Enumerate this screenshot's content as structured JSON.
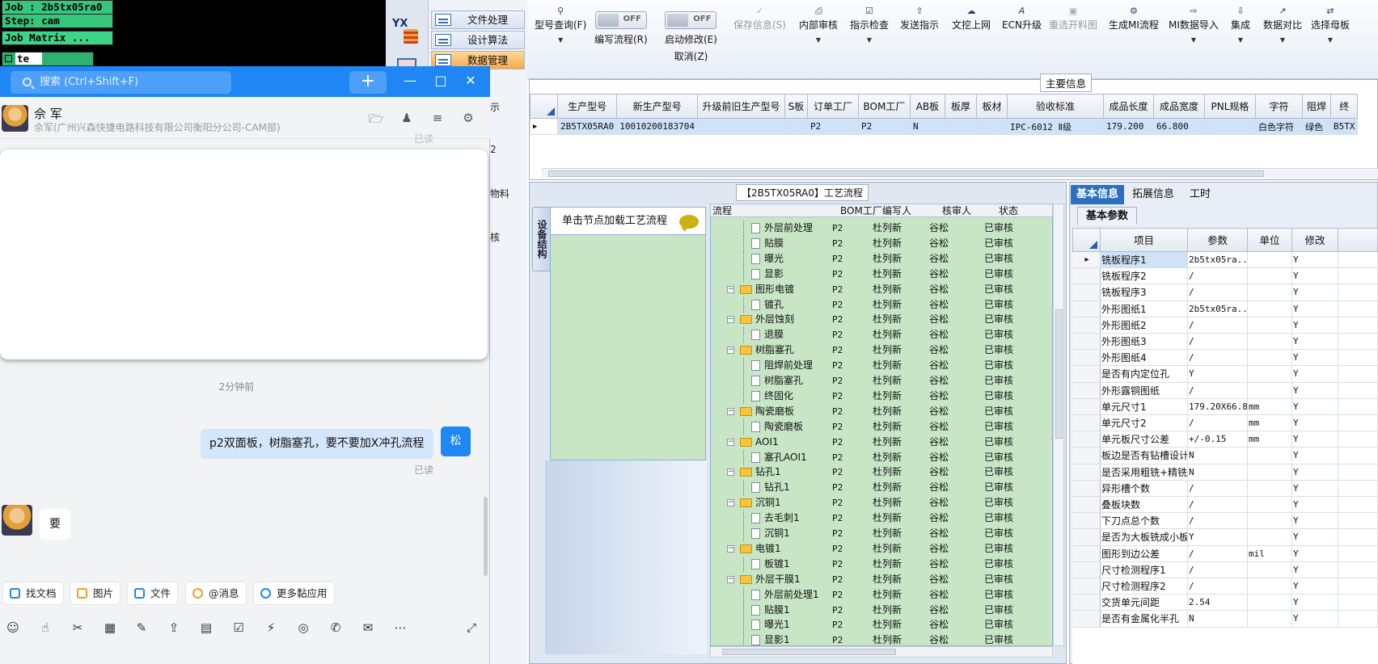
{
  "terminal": {
    "lines": [
      "Job : 2b5tx05ra0",
      "Step: cam",
      "Job Matrix ..."
    ],
    "input": "te"
  },
  "erp": {
    "logo": "YX",
    "menu": [
      {
        "label": "文件处理"
      },
      {
        "label": "设计算法"
      },
      {
        "label": "数据管理"
      }
    ],
    "side_fragments": [
      "示",
      "2",
      "物料",
      "核"
    ],
    "toolbar": [
      {
        "label": "型号查询(F)",
        "icon": "search-icon",
        "caret": "▼"
      },
      {
        "label": "编写流程(R)",
        "toggle": "OFF"
      },
      {
        "label": "启动修改(E)",
        "sub": "取消(Z)",
        "toggle": "OFF"
      },
      {
        "label": "保存信息(S)",
        "icon": "check-icon"
      },
      {
        "label": "内部审核",
        "icon": "print-icon",
        "caret": "▼"
      },
      {
        "label": "指示检查",
        "icon": "checkbox-icon",
        "caret": "▼"
      },
      {
        "label": "发送指示",
        "icon": "upload-icon"
      },
      {
        "label": "文挖上网",
        "icon": "cloud-upload-icon"
      },
      {
        "label": "ECN升级",
        "icon": "font-a-icon"
      },
      {
        "label": "重选开料图",
        "icon": "image-icon"
      },
      {
        "label": "生成MI流程",
        "icon": "gear-group-icon"
      },
      {
        "label": "MI数据导入",
        "icon": "import-icon",
        "caret": "▼"
      },
      {
        "label": "集成",
        "icon": "download-icon",
        "caret": "▼"
      },
      {
        "label": "数据对比",
        "icon": "compare-icon",
        "caret": "▼"
      },
      {
        "label": "选择母板",
        "icon": "shuffle-icon",
        "caret": "▼"
      }
    ],
    "main_info": {
      "title": "主要信息",
      "headers": [
        "生产型号",
        "新生产型号",
        "升级前旧生产型号",
        "S板",
        "订单工厂",
        "BOM工厂",
        "AB板",
        "板厚",
        "板材",
        "验收标准",
        "成品长度",
        "成品宽度",
        "PNL规格",
        "字符",
        "阻焊",
        "终"
      ],
      "row": [
        "2B5TX05RA0",
        "10010200183704",
        "",
        "",
        "P2",
        "P2",
        "N",
        "",
        "",
        "IPC-6012 Ⅱ级",
        "179.200",
        "66.800",
        "",
        "白色字符",
        "绿色",
        "B5TX"
      ]
    },
    "process": {
      "title": "【2B5TX05RA0】工艺流程",
      "vertical_tab": "设备结构",
      "load_hint": "单击节点加载工艺流程",
      "columns": [
        "流程",
        "BOM工厂",
        "编写人",
        "核审人",
        "状态"
      ],
      "rows": [
        {
          "name": "外层前处理",
          "level": 2,
          "bom": "P2",
          "writer": "杜列新",
          "reviewer": "谷松",
          "status": "已审核"
        },
        {
          "name": "贴膜",
          "level": 2,
          "bom": "P2",
          "writer": "杜列新",
          "reviewer": "谷松",
          "status": "已审核"
        },
        {
          "name": "曝光",
          "level": 2,
          "bom": "P2",
          "writer": "杜列新",
          "reviewer": "谷松",
          "status": "已审核"
        },
        {
          "name": "显影",
          "level": 2,
          "bom": "P2",
          "writer": "杜列新",
          "reviewer": "谷松",
          "status": "已审核"
        },
        {
          "name": "图形电镀",
          "level": 1,
          "bom": "P2",
          "writer": "杜列新",
          "reviewer": "谷松",
          "status": "已审核"
        },
        {
          "name": "镀孔",
          "level": 2,
          "bom": "P2",
          "writer": "杜列新",
          "reviewer": "谷松",
          "status": "已审核"
        },
        {
          "name": "外层蚀刻",
          "level": 1,
          "bom": "P2",
          "writer": "杜列新",
          "reviewer": "谷松",
          "status": "已审核"
        },
        {
          "name": "退膜",
          "level": 2,
          "bom": "P2",
          "writer": "杜列新",
          "reviewer": "谷松",
          "status": "已审核"
        },
        {
          "name": "树脂塞孔",
          "level": 1,
          "bom": "P2",
          "writer": "杜列新",
          "reviewer": "谷松",
          "status": "已审核"
        },
        {
          "name": "阻焊前处理",
          "level": 2,
          "bom": "P2",
          "writer": "杜列新",
          "reviewer": "谷松",
          "status": "已审核"
        },
        {
          "name": "树脂塞孔",
          "level": 2,
          "bom": "P2",
          "writer": "杜列新",
          "reviewer": "谷松",
          "status": "已审核"
        },
        {
          "name": "终固化",
          "level": 2,
          "bom": "P2",
          "writer": "杜列新",
          "reviewer": "谷松",
          "status": "已审核"
        },
        {
          "name": "陶瓷磨板",
          "level": 1,
          "bom": "P2",
          "writer": "杜列新",
          "reviewer": "谷松",
          "status": "已审核"
        },
        {
          "name": "陶瓷磨板",
          "level": 2,
          "bom": "P2",
          "writer": "杜列新",
          "reviewer": "谷松",
          "status": "已审核"
        },
        {
          "name": "AOI1",
          "level": 1,
          "bom": "P2",
          "writer": "杜列新",
          "reviewer": "谷松",
          "status": "已审核"
        },
        {
          "name": "塞孔AOI1",
          "level": 2,
          "bom": "P2",
          "writer": "杜列新",
          "reviewer": "谷松",
          "status": "已审核"
        },
        {
          "name": "钻孔1",
          "level": 1,
          "bom": "P2",
          "writer": "杜列新",
          "reviewer": "谷松",
          "status": "已审核"
        },
        {
          "name": "钻孔1",
          "level": 2,
          "bom": "P2",
          "writer": "杜列新",
          "reviewer": "谷松",
          "status": "已审核"
        },
        {
          "name": "沉铜1",
          "level": 1,
          "bom": "P2",
          "writer": "杜列新",
          "reviewer": "谷松",
          "status": "已审核"
        },
        {
          "name": "去毛刺1",
          "level": 2,
          "bom": "P2",
          "writer": "杜列新",
          "reviewer": "谷松",
          "status": "已审核"
        },
        {
          "name": "沉铜1",
          "level": 2,
          "bom": "P2",
          "writer": "杜列新",
          "reviewer": "谷松",
          "status": "已审核"
        },
        {
          "name": "电镀1",
          "level": 1,
          "bom": "P2",
          "writer": "杜列新",
          "reviewer": "谷松",
          "status": "已审核"
        },
        {
          "name": "板镀1",
          "level": 2,
          "bom": "P2",
          "writer": "杜列新",
          "reviewer": "谷松",
          "status": "已审核"
        },
        {
          "name": "外层干膜1",
          "level": 1,
          "bom": "P2",
          "writer": "杜列新",
          "reviewer": "谷松",
          "status": "已审核"
        },
        {
          "name": "外层前处理1",
          "level": 2,
          "bom": "P2",
          "writer": "杜列新",
          "reviewer": "谷松",
          "status": "已审核"
        },
        {
          "name": "贴膜1",
          "level": 2,
          "bom": "P2",
          "writer": "杜列新",
          "reviewer": "谷松",
          "status": "已审核"
        },
        {
          "name": "曝光1",
          "level": 2,
          "bom": "P2",
          "writer": "杜列新",
          "reviewer": "谷松",
          "status": "已审核"
        },
        {
          "name": "显影1",
          "level": 2,
          "bom": "P2",
          "writer": "杜列新",
          "reviewer": "谷松",
          "status": "已审核"
        }
      ]
    },
    "right": {
      "tabs": [
        "基本信息",
        "拓展信息",
        "工时"
      ],
      "subtab": "基本参数",
      "headers": [
        "项目",
        "参数",
        "单位",
        "修改"
      ],
      "rows": [
        [
          "铣板程序1",
          "2b5tx05ra...",
          "",
          "Y"
        ],
        [
          "铣板程序2",
          "/",
          "",
          "Y"
        ],
        [
          "铣板程序3",
          "/",
          "",
          "Y"
        ],
        [
          "外形图纸1",
          "2b5tx05ra...",
          "",
          "Y"
        ],
        [
          "外形图纸2",
          "/",
          "",
          "Y"
        ],
        [
          "外形图纸3",
          "/",
          "",
          "Y"
        ],
        [
          "外形图纸4",
          "/",
          "",
          "Y"
        ],
        [
          "是否有内定位孔",
          "Y",
          "",
          "Y"
        ],
        [
          "外形露铜图纸",
          "/",
          "",
          "Y"
        ],
        [
          "单元尺寸1",
          "179.20X66.80",
          "mm",
          "Y"
        ],
        [
          "单元尺寸2",
          "/",
          "mm",
          "Y"
        ],
        [
          "单元板尺寸公差",
          "+/-0.15",
          "mm",
          "Y"
        ],
        [
          "板边是否有钻槽设计",
          "N",
          "",
          "Y"
        ],
        [
          "是否采用粗铣+精铣",
          "N",
          "",
          "Y"
        ],
        [
          "异形槽个数",
          "/",
          "",
          "Y"
        ],
        [
          "叠板块数",
          "/",
          "",
          "Y"
        ],
        [
          "下刀点总个数",
          "/",
          "",
          "Y"
        ],
        [
          "是否为大板铣成小板",
          "Y",
          "",
          "Y"
        ],
        [
          "图形到边公差",
          "/",
          "mil",
          "Y"
        ],
        [
          "尺寸检测程序1",
          "/",
          "",
          "Y"
        ],
        [
          "尺寸检测程序2",
          "/",
          "",
          "Y"
        ],
        [
          "交货单元间距",
          "2.54",
          "",
          "Y"
        ],
        [
          "是否有金属化半孔",
          "N",
          "",
          "Y"
        ]
      ]
    }
  },
  "chat": {
    "search_placeholder": "搜索 (Ctrl+Shift+F)",
    "contact_name": "佘 军",
    "contact_org": "佘军(广州兴森快捷电路科技有限公司衡阳分公司-CAM部)",
    "read_top": "已读",
    "time": "2分钟前",
    "outgoing": "p2双面板，树脂塞孔，要不要加X冲孔流程",
    "me_initial": "松",
    "read": "已读",
    "incoming": "要",
    "quick_actions": [
      "找文档",
      "图片",
      "文件",
      "@消息",
      "更多黏应用"
    ],
    "colors": {
      "brand": "#1e86f5",
      "bubble_out": "#d4e6fc"
    }
  }
}
